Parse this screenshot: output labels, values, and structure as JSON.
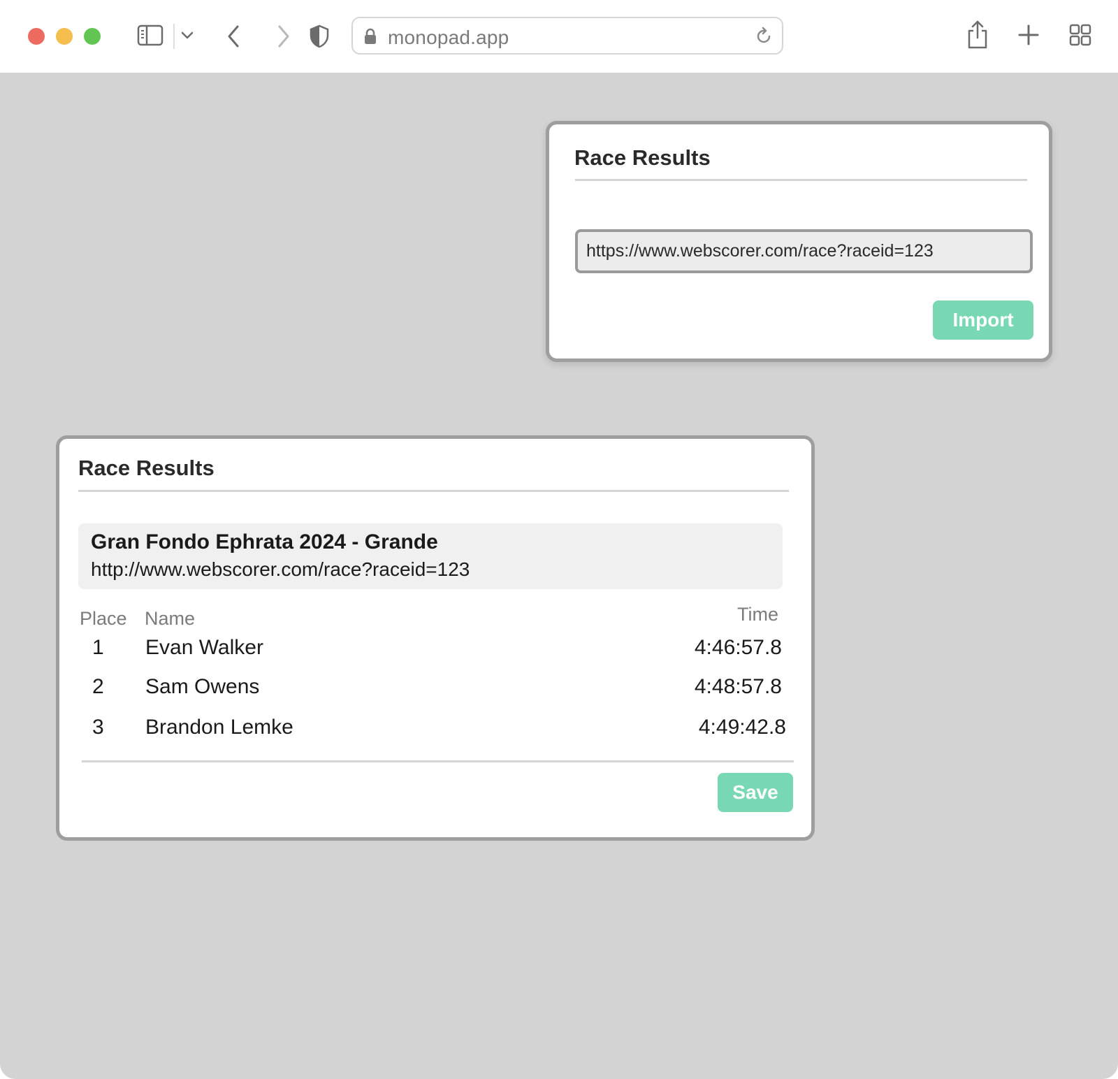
{
  "browser": {
    "url": "monopad.app"
  },
  "import_card": {
    "title": "Race Results",
    "url_value": "https://www.webscorer.com/race?raceid=123",
    "import_label": "Import"
  },
  "results_card": {
    "title": "Race Results",
    "race_name": "Gran Fondo Ephrata 2024 - Grande",
    "race_url": "http://www.webscorer.com/race?raceid=123",
    "columns": {
      "place": "Place",
      "name": "Name",
      "time": "Time"
    },
    "rows": [
      {
        "place": "1",
        "name": "Evan Walker",
        "time": "4:46:57.8"
      },
      {
        "place": "2",
        "name": "Sam Owens",
        "time": "4:48:57.8"
      },
      {
        "place": "3",
        "name": "Brandon Lemke",
        "time": "4:49:42.8"
      }
    ],
    "save_label": "Save"
  },
  "colors": {
    "accent_button": "#79d8b4",
    "canvas_background": "#d3d3d3"
  }
}
